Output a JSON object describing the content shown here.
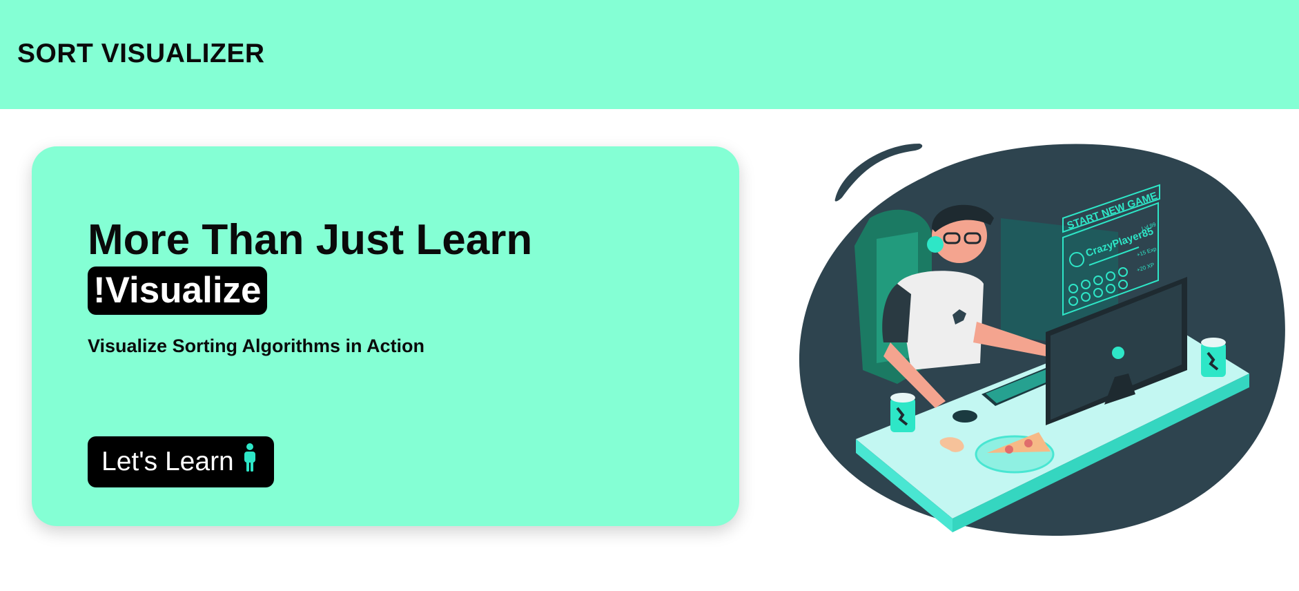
{
  "navbar": {
    "brand": "SORT VISUALIZER"
  },
  "hero": {
    "title": "More Than Just Learn",
    "highlight": "!Visualize",
    "subtitle": "Visualize Sorting Algorithms in Action",
    "cta_label": "Let's Learn",
    "cta_icon": "person-standing-icon"
  },
  "illustration": {
    "game_screen": {
      "start_label": "START NEW GAME",
      "player_name": "CrazyPlayer85",
      "level": "Lvl 99",
      "exp": "+15 Exp",
      "xp": "+20 XP"
    }
  },
  "colors": {
    "accent": "#84ffd4",
    "teal": "#2ee6c7",
    "dark": "#2e444f",
    "black": "#000000"
  }
}
